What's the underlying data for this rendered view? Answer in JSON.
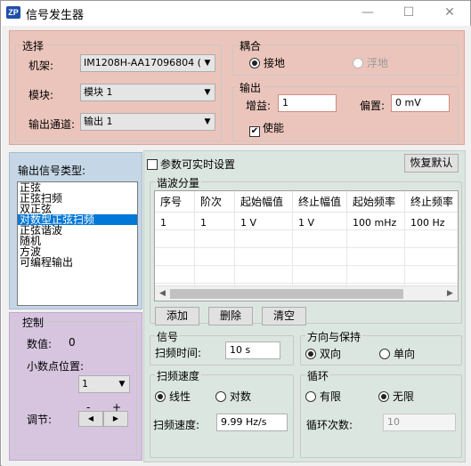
{
  "window": {
    "app_icon": "ZP",
    "title": "信号发生器",
    "minimize_glyph": "—",
    "maximize_glyph": "☐",
    "close_glyph": "✕"
  },
  "select_group": {
    "label": "选择",
    "rack_label": "机架:",
    "rack_value": "IM1208H-AA17096804 (1!",
    "module_label": "模块:",
    "module_value": "模块 1",
    "channel_label": "输出通道:",
    "channel_value": "输出 1"
  },
  "coupling_group": {
    "label": "耦合",
    "ground": "接地",
    "floating": "浮地"
  },
  "output_group": {
    "label": "输出",
    "gain_label": "增益:",
    "gain_value": "1",
    "offset_label": "偏置:",
    "offset_value": "0 mV",
    "enable_label": "使能",
    "enable_checked": true
  },
  "signal_type": {
    "label": "输出信号类型:",
    "items": [
      "正弦",
      "正弦扫频",
      "双正弦",
      "对数型正弦扫频",
      "正弦谐波",
      "随机",
      "方波",
      "可编程输出"
    ],
    "selected_index": 3
  },
  "control": {
    "label": "控制",
    "value_label": "数值:",
    "value": "0",
    "decimal_label": "小数点位置:",
    "decimal_value": "1",
    "adjust_label": "调节:",
    "minus": "-",
    "plus": "+",
    "left_arrow": "◀",
    "right_arrow": "▶"
  },
  "top": {
    "realtime_label": "参数可实时设置",
    "reset_label": "恢复默认"
  },
  "harmonics": {
    "label": "谐波分量",
    "columns": [
      "序号",
      "阶次",
      "起始幅值",
      "终止幅值",
      "起始频率",
      "终止频率"
    ],
    "rows": [
      [
        "1",
        "1",
        "1 V",
        "1 V",
        "100 mHz",
        "100 Hz"
      ]
    ],
    "add": "添加",
    "delete": "删除",
    "clear": "清空"
  },
  "signal": {
    "label": "信号",
    "sweep_time_label": "扫频时间:",
    "sweep_time_value": "10 s"
  },
  "direction": {
    "label": "方向与保持",
    "bidirectional": "双向",
    "unidirectional": "单向"
  },
  "sweep_speed": {
    "label": "扫频速度",
    "linear": "线性",
    "log": "对数",
    "speed_label": "扫频速度:",
    "speed_value": "9.99 Hz/s"
  },
  "loop": {
    "label": "循环",
    "finite": "有限",
    "infinite": "无限",
    "count_label": "循环次数:",
    "count_value": "10"
  },
  "colors": {
    "select_panel": "#ebc5bb",
    "type_panel": "#c5d6e6",
    "control_panel": "#d7c5e0",
    "main_panel": "#dbe6e0",
    "selection": "#0078d7"
  }
}
